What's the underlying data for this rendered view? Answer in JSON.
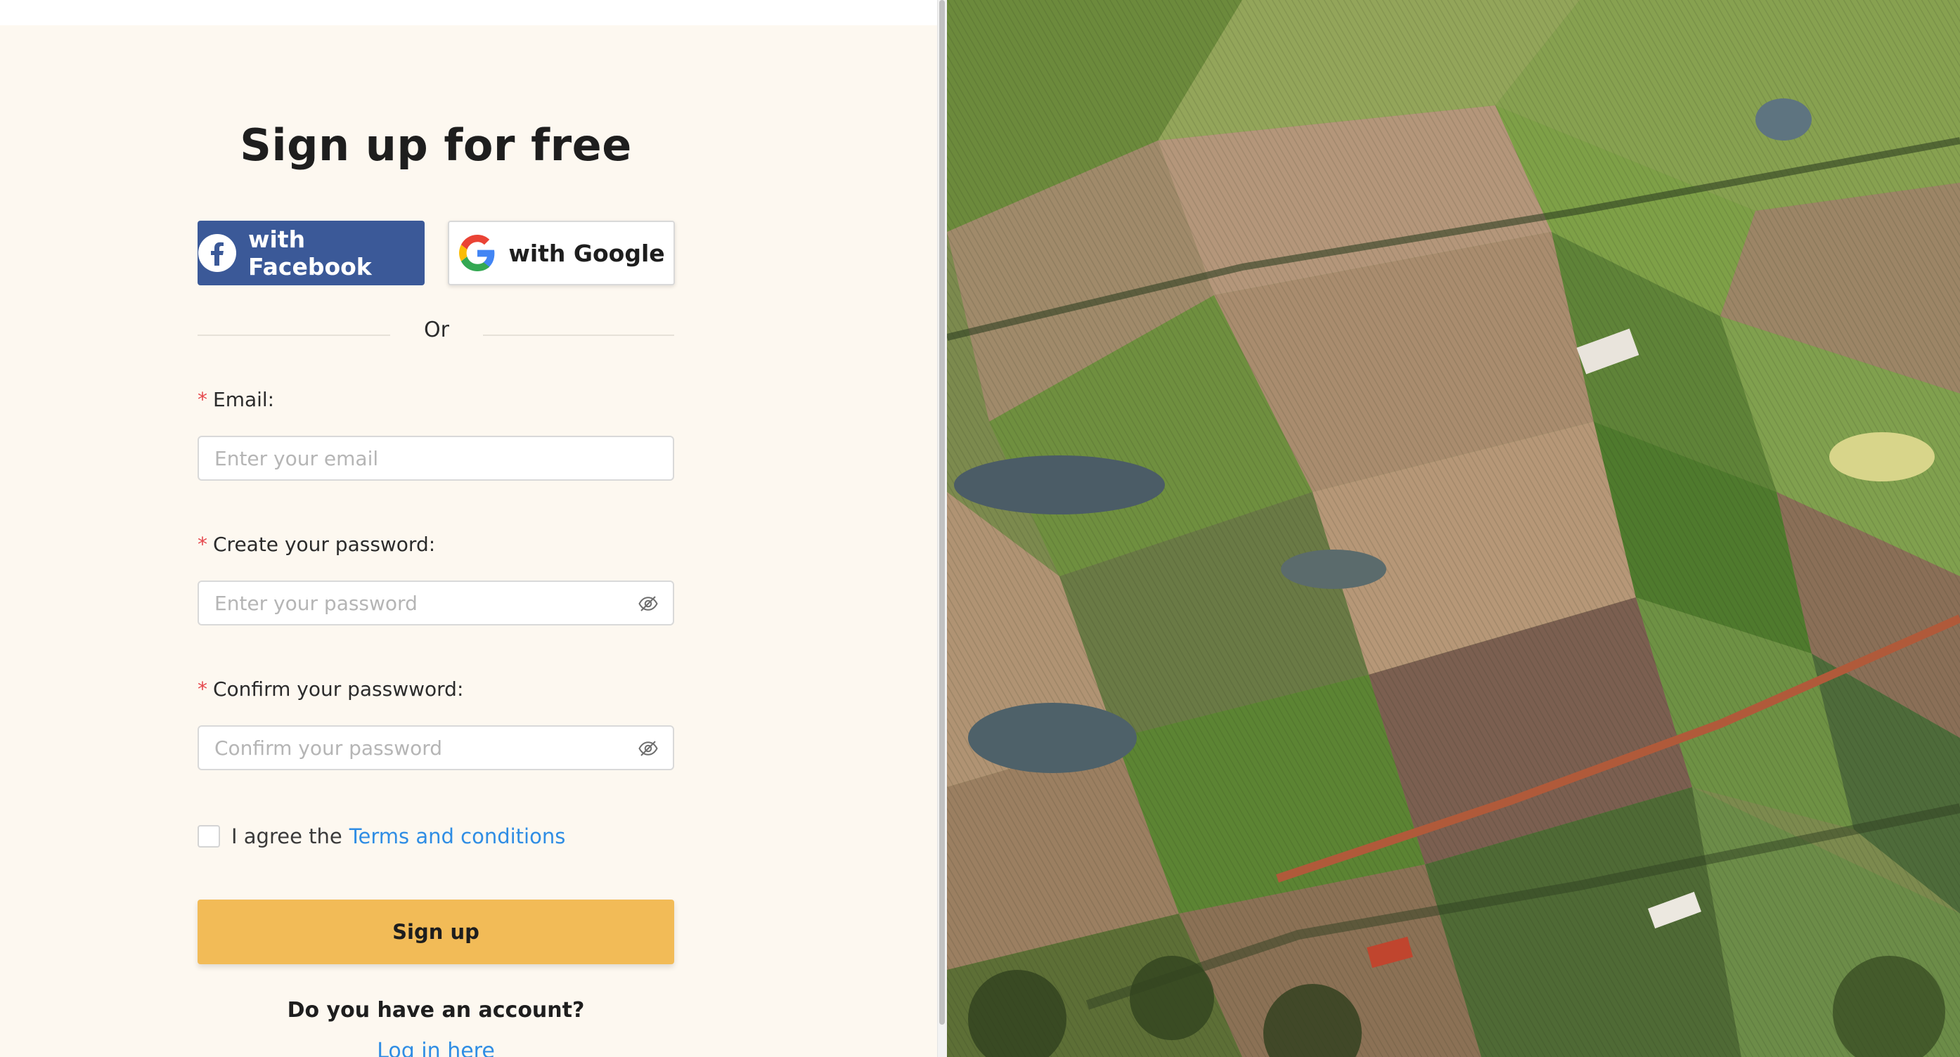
{
  "signup": {
    "title": "Sign up for free",
    "facebook_label": "with Facebook",
    "google_label": "with Google",
    "divider_text": "Or",
    "required_mark": "*",
    "email": {
      "label": "Email:",
      "placeholder": "Enter your email"
    },
    "password": {
      "label": "Create your password:",
      "placeholder": "Enter your password"
    },
    "confirm": {
      "label": "Confirm your passwword:",
      "placeholder": "Confirm your password"
    },
    "terms_prefix": "I agree the",
    "terms_link": "Terms and conditions",
    "submit_label": "Sign up",
    "have_account": "Do you have an account?",
    "login_link": "Log in here"
  },
  "colors": {
    "facebook": "#3b5998",
    "submit": "#f2bb57",
    "link": "#2f8de4",
    "required": "#e5484d",
    "panel_background": "#fdf8f0"
  },
  "icons": {
    "facebook": "facebook-icon",
    "google": "google-icon",
    "password_toggle": "eye-slash-icon"
  },
  "photo": {
    "subject": "aerial view of farmland fields"
  }
}
